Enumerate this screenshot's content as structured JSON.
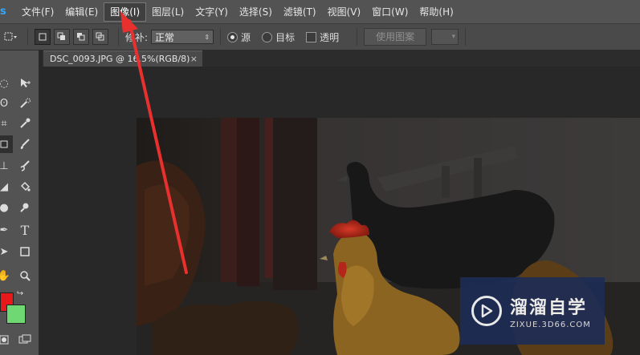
{
  "app": {
    "logo": "s"
  },
  "menu": [
    {
      "label": "文件(F)"
    },
    {
      "label": "编辑(E)"
    },
    {
      "label": "图像(I)"
    },
    {
      "label": "图层(L)"
    },
    {
      "label": "文字(Y)"
    },
    {
      "label": "选择(S)"
    },
    {
      "label": "滤镜(T)"
    },
    {
      "label": "视图(V)"
    },
    {
      "label": "窗口(W)"
    },
    {
      "label": "帮助(H)"
    }
  ],
  "options": {
    "patch_label": "修补:",
    "patch_value": "正常",
    "source_label": "源",
    "target_label": "目标",
    "transparent_label": "透明",
    "use_pattern_label": "使用图案"
  },
  "document": {
    "tab_title": "DSC_0093.JPG @ 16.5%(RGB/8)",
    "close_glyph": "×"
  },
  "watermark": {
    "name": "溜溜自学",
    "url": "ZIXUE.3D66.COM"
  },
  "colors": {
    "foreground": "#e8191a",
    "background": "#6fd873",
    "annotation_arrow": "#e8302e"
  }
}
